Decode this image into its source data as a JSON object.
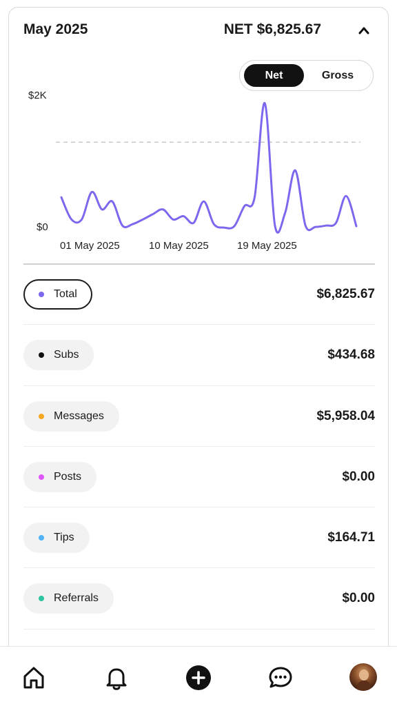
{
  "header": {
    "month": "May 2025",
    "net_total": "NET $6,825.67"
  },
  "toggle": {
    "net_label": "Net",
    "gross_label": "Gross",
    "selected": "Net"
  },
  "chart_data": {
    "type": "line",
    "title": "",
    "y_tick_labels": [
      "$2K",
      "$0"
    ],
    "x_tick_labels": [
      "01 May 2025",
      "10 May 2025",
      "19 May 2025"
    ],
    "ylim": [
      0,
      2000
    ],
    "reference_line_value": 1300,
    "line_color": "#7B68EE",
    "series": [
      {
        "values": [
          [
            1,
            480
          ],
          [
            2,
            150
          ],
          [
            3,
            150
          ],
          [
            4,
            560
          ],
          [
            5,
            300
          ],
          [
            6,
            420
          ],
          [
            7,
            60
          ],
          [
            8,
            80
          ],
          [
            9,
            150
          ],
          [
            10,
            230
          ],
          [
            11,
            300
          ],
          [
            12,
            150
          ],
          [
            13,
            200
          ],
          [
            14,
            100
          ],
          [
            15,
            420
          ],
          [
            16,
            80
          ],
          [
            17,
            30
          ],
          [
            18,
            50
          ],
          [
            19,
            350
          ],
          [
            20,
            480
          ],
          [
            21,
            1880
          ],
          [
            22,
            60
          ],
          [
            23,
            250
          ],
          [
            24,
            880
          ],
          [
            25,
            60
          ],
          [
            26,
            40
          ],
          [
            27,
            60
          ],
          [
            28,
            100
          ],
          [
            29,
            500
          ],
          [
            30,
            50
          ]
        ]
      }
    ]
  },
  "breakdown": [
    {
      "label": "Total",
      "amount": "$6,825.67",
      "dot_color": "#7B68EE",
      "active": true
    },
    {
      "label": "Subs",
      "amount": "$434.68",
      "dot_color": "#111111",
      "active": false
    },
    {
      "label": "Messages",
      "amount": "$5,958.04",
      "dot_color": "#F5A623",
      "active": false
    },
    {
      "label": "Posts",
      "amount": "$0.00",
      "dot_color": "#E056FD",
      "active": false
    },
    {
      "label": "Tips",
      "amount": "$164.71",
      "dot_color": "#4FB3F6",
      "active": false
    },
    {
      "label": "Referrals",
      "amount": "$0.00",
      "dot_color": "#2EC4A0",
      "active": false
    }
  ],
  "nav": {
    "items": [
      "home-icon",
      "bell-icon",
      "add-icon",
      "chat-icon",
      "avatar"
    ]
  }
}
